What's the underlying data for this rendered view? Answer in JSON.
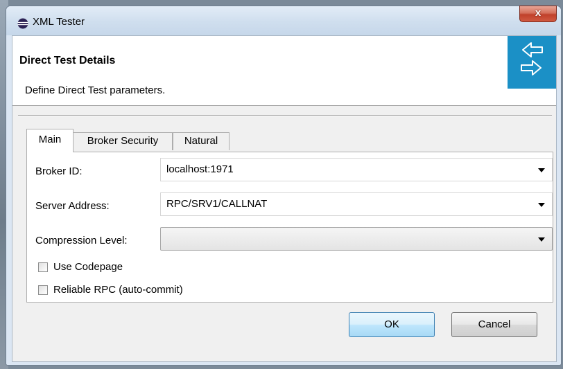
{
  "window": {
    "title": "XML Tester",
    "close_glyph": "x"
  },
  "header": {
    "title": "Direct Test Details",
    "description": "Define Direct Test parameters.",
    "icon": "double-arrows-icon",
    "icon_color": "#1b90c6"
  },
  "tabs": [
    {
      "label": "Main",
      "selected": true
    },
    {
      "label": "Broker Security",
      "selected": false
    },
    {
      "label": "Natural",
      "selected": false
    }
  ],
  "form": {
    "broker_id": {
      "label": "Broker ID:",
      "value": "localhost:1971"
    },
    "server_address": {
      "label": "Server Address:",
      "value": "RPC/SRV1/CALLNAT"
    },
    "compression_level": {
      "label": "Compression Level:",
      "value": ""
    },
    "use_codepage": {
      "label": "Use Codepage",
      "checked": false
    },
    "reliable_rpc": {
      "label": "Reliable RPC (auto-commit)",
      "checked": false
    }
  },
  "buttons": {
    "ok": "OK",
    "cancel": "Cancel"
  }
}
